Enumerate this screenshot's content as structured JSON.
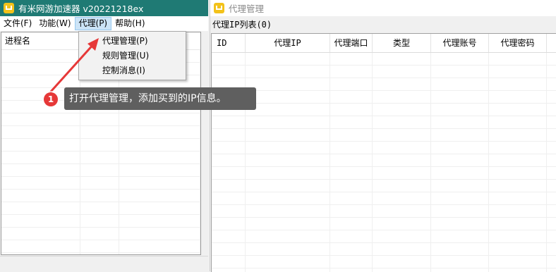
{
  "main_window": {
    "title": "有米网游加速器 v20221218ex",
    "menu": [
      "文件(F)",
      "功能(W)",
      "代理(P)",
      "帮助(H)"
    ],
    "active_menu_index": 2,
    "process_list": {
      "header": "进程名"
    }
  },
  "proxy_dropdown": {
    "items": [
      "代理管理(P)",
      "规则管理(U)",
      "控制消息(I)"
    ]
  },
  "annotation": {
    "step": "1",
    "hint": "打开代理管理，添加买到的IP信息。"
  },
  "proxy_window": {
    "title": "代理管理",
    "section_label": "代理IP列表(0)",
    "columns": [
      "ID",
      "代理IP",
      "代理端口",
      "类型",
      "代理账号",
      "代理密码"
    ]
  },
  "colors": {
    "main_title_bar": "#1f7a74",
    "menu_highlight": "#cce4f7",
    "badge": "#e63838",
    "hint_bg": "#5f5f5f",
    "app_icon": "#f3c21a"
  },
  "icons": {
    "app": "app-logo-icon",
    "arrow": "pointer-arrow-icon"
  }
}
